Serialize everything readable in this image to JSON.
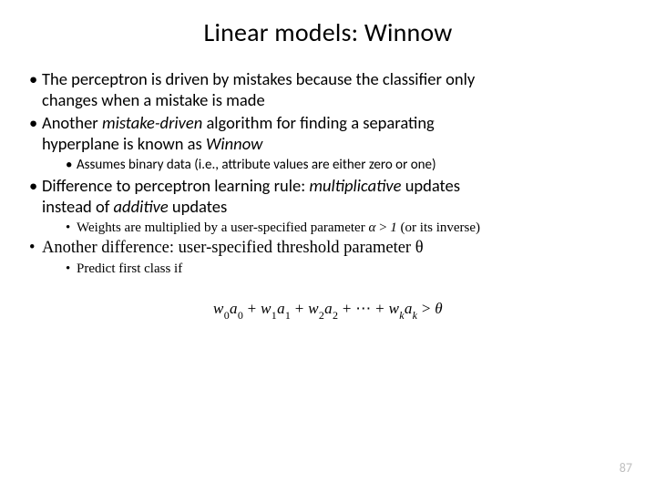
{
  "title": "Linear models: Winnow",
  "bullets": {
    "b1a": "The perceptron is driven by mistakes because the classifier only",
    "b1b": "changes when a mistake is made",
    "b2a": "Another ",
    "b2b": "mistake-driven",
    "b2c": " algorithm for finding a separating",
    "b2d": "hyperplane is known as ",
    "b2e": "Winnow",
    "s1": "Assumes binary data (i.e., attribute values are either zero or one)",
    "b3a": "Difference to perceptron learning rule: ",
    "b3b": "multiplicative",
    "b3c": " updates",
    "b3d": "instead of ",
    "b3e": "additive",
    "b3f": " updates",
    "s2a": "Weights are multiplied by a user-specified parameter ",
    "s2b": "α",
    "s2c": " > ",
    "s2d": "1",
    "s2e": " (or its inverse)",
    "b4a": "Another difference: user-specified threshold parameter ",
    "b4b": "θ",
    "s3": "Predict first class if"
  },
  "formula": {
    "w": "w",
    "a": "a",
    "plus": " + ",
    "dots": " + ⋯ + ",
    "k": "k",
    "gt": " > ",
    "theta": "θ",
    "n0": "0",
    "n1": "1",
    "n2": "2"
  },
  "page_number": "87"
}
